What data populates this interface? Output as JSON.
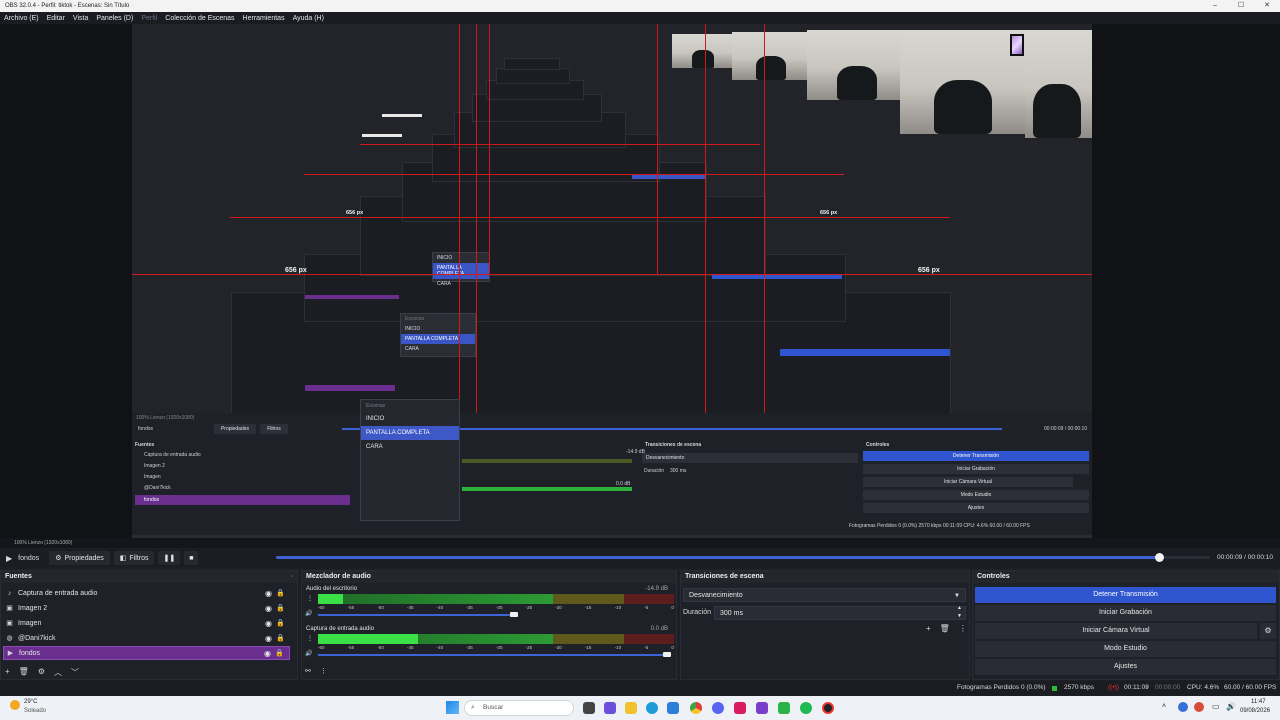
{
  "window": {
    "title": "OBS 32.0.4 - Perfil: tiktok - Escenas: Sin Título",
    "controls": [
      "–",
      "☐",
      "✕"
    ]
  },
  "menu": {
    "items": [
      "Archivo (E)",
      "Editar",
      "Vista",
      "Paneles (D)",
      "Perfil",
      "Colección de Escenas",
      "Herramientas",
      "Ayuda (H)"
    ],
    "disabled_index": 4
  },
  "preview": {
    "measure_label": "656 px",
    "nested": {
      "scene_name": "fondos",
      "properties": "Propiedades",
      "filters": "Filtros",
      "time": "00:00:09 / 00:00:10",
      "sources_header": "Fuentes",
      "sources": [
        "Captura de entrada audio",
        "Imagen 2",
        "Imagen",
        "@Dani7kick",
        "fondos"
      ],
      "transitions_header": "Transiciones de escena",
      "transition": "Desvanecimiento",
      "duration_label": "Duración",
      "duration": "300 ms",
      "controls_header": "Controles",
      "controls": [
        "Detener Transmisión",
        "Iniciar Grabación",
        "Iniciar Cámara Virtual",
        "Modo Estudio",
        "Ajustes"
      ],
      "stats": "Fotogramas Perdidos 0 (0.0%)   2570 kbps   00:11:09   CPU: 4.6%   60.00 / 60.00 FPS",
      "zoom": "100%   Lienzo (1920x1080)",
      "db_a": "-14.9 dB",
      "db_b": "0.0 dB"
    },
    "scenes_popup": {
      "header": "Escenas",
      "items": [
        "INICIO",
        "PANTALLA COMPLETA",
        "CARA"
      ],
      "selected_index": 1
    }
  },
  "canvas_status": "100%     Lienzo (1920x1080)",
  "controls_bar": {
    "scene_name": "fondos",
    "properties": "Propiedades",
    "filters": "Filtros",
    "timecode": "00:00:09 / 00:00:10",
    "progress_fraction": 0.945
  },
  "sources": {
    "header": "Fuentes",
    "items": [
      {
        "label": "Captura de entrada audio",
        "icon": "speaker-icon",
        "selected": false
      },
      {
        "label": "Imagen 2",
        "icon": "image-icon",
        "selected": false
      },
      {
        "label": "Imagen",
        "icon": "image-icon",
        "selected": false
      },
      {
        "label": "@Dani7kick",
        "icon": "browser-icon",
        "selected": false
      },
      {
        "label": "fondos",
        "icon": "play-icon",
        "selected": true
      }
    ]
  },
  "mixer": {
    "header": "Mezclador de audio",
    "channels": [
      {
        "name": "Audio del escritorio",
        "db": "-14.9 dB",
        "level_fraction": 0.07,
        "volume_fraction": 0.55
      },
      {
        "name": "Captura de entrada audio",
        "db": "0.0 dB",
        "level_fraction": 0.28,
        "volume_fraction": 0.98
      }
    ],
    "ticks": [
      "-60",
      "-55",
      "-50",
      "-45",
      "-40",
      "-35",
      "-30",
      "-25",
      "-20",
      "-15",
      "-10",
      "-5",
      "0"
    ]
  },
  "transitions": {
    "header": "Transiciones de escena",
    "selected": "Desvanecimiento",
    "duration_label": "Duración",
    "duration": "300 ms"
  },
  "controls": {
    "header": "Controles",
    "buttons": [
      "Detener Transmisión",
      "Iniciar Grabación",
      "Iniciar Cámara Virtual",
      "Modo Estudio",
      "Ajustes"
    ]
  },
  "stats": {
    "dropped": "Fotogramas Perdidos 0 (0.0%)",
    "bitrate": "2570 kbps",
    "stream_time": "00:11:09",
    "rec_time": "00:00:00",
    "cpu": "CPU: 4.6%",
    "fps": "60.00 / 60.00 FPS"
  },
  "taskbar": {
    "weather_temp": "29°C",
    "weather_text": "Soleado",
    "search": "Buscar",
    "time": "11:47",
    "date": "09/08/2026"
  },
  "colors": {
    "accent": "#2f55cf",
    "selected_source": "#6a2f8e",
    "guide_red": "#d01a1a"
  }
}
